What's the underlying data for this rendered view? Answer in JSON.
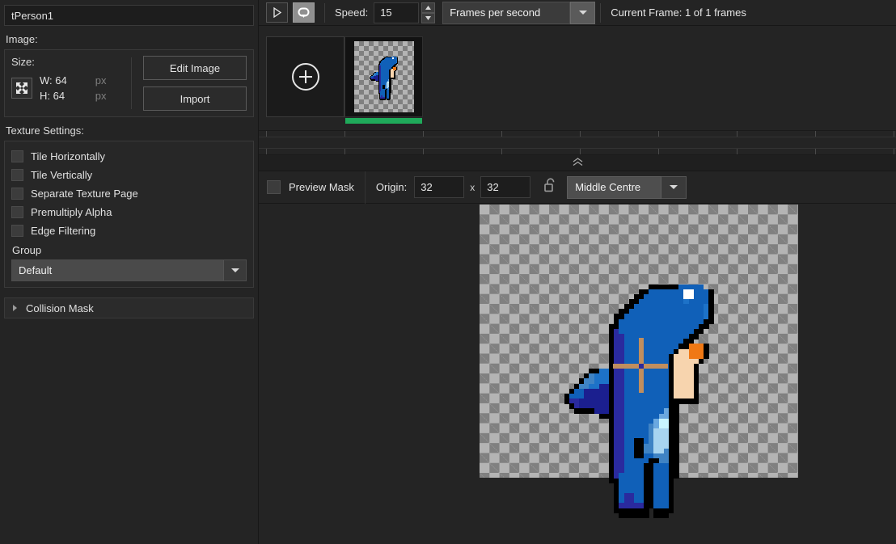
{
  "sidebar": {
    "sprite_name": "tPerson1",
    "image_label": "Image:",
    "size": {
      "title": "Size:",
      "width_label": "W: 64",
      "height_label": "H: 64",
      "unit_w": "px",
      "unit_h": "px",
      "resize_icon": "resize-arrows-icon"
    },
    "buttons": {
      "edit_image": "Edit Image",
      "import": "Import"
    },
    "texture_settings_label": "Texture Settings:",
    "checkboxes": [
      {
        "label": "Tile Horizontally",
        "checked": false
      },
      {
        "label": "Tile Vertically",
        "checked": false
      },
      {
        "label": "Separate Texture Page",
        "checked": false
      },
      {
        "label": "Premultiply Alpha",
        "checked": false
      },
      {
        "label": "Edge Filtering",
        "checked": false
      }
    ],
    "group": {
      "title": "Group",
      "value": "Default",
      "arrow_icon": "chevron-down-icon"
    },
    "collision_mask": {
      "label": "Collision Mask",
      "expander_icon": "triangle-right-icon",
      "expanded": false
    }
  },
  "toolbar": {
    "play_icon": "play-icon",
    "loop_icon": "loop-icon",
    "loop_active": true,
    "speed_label": "Speed:",
    "speed_value": "15",
    "spinner_up_icon": "spinner-up-icon",
    "spinner_down_icon": "spinner-down-icon",
    "speed_unit": "Frames per second",
    "speed_unit_arrow_icon": "chevron-down-icon",
    "current_frame": "Current Frame: 1 of 1 frames"
  },
  "filmstrip": {
    "add_frame_icon": "plus-circle-icon",
    "selected_frame_index": 1,
    "selected_marker_color": "#1faa5a",
    "tick_positions": [
      0,
      97,
      194,
      291,
      388,
      485,
      582,
      679,
      776
    ]
  },
  "collapse": {
    "icon": "double-chevron-up-icon"
  },
  "origin_bar": {
    "preview_mask_label": "Preview Mask",
    "preview_mask_checked": false,
    "origin_label": "Origin:",
    "origin_x": "32",
    "separator": "x",
    "origin_y": "32",
    "lock_icon": "unlocked-padlock-icon",
    "preset": "Middle Centre",
    "preset_arrow_icon": "chevron-down-icon"
  },
  "canvas": {
    "background": "checkerboard-transparency",
    "origin_crosshair_color": "#c08e5e",
    "palette": {
      "outline": "#000000",
      "blue_mid": "#1060b8",
      "blue_dark": "#1b1f8f",
      "blue_deep": "#2a2a9e",
      "blue_bright": "#1d72c8",
      "blue_light": "#6aa8e0",
      "blue_pale": "#a8d4f0",
      "cyan_pale": "#c8f4ff",
      "blue_steel": "#3f83c4",
      "skin": "#f7d4ae",
      "hair_orange": "#f07814",
      "white": "#ffffff",
      "staff": "#c08e5e"
    }
  }
}
